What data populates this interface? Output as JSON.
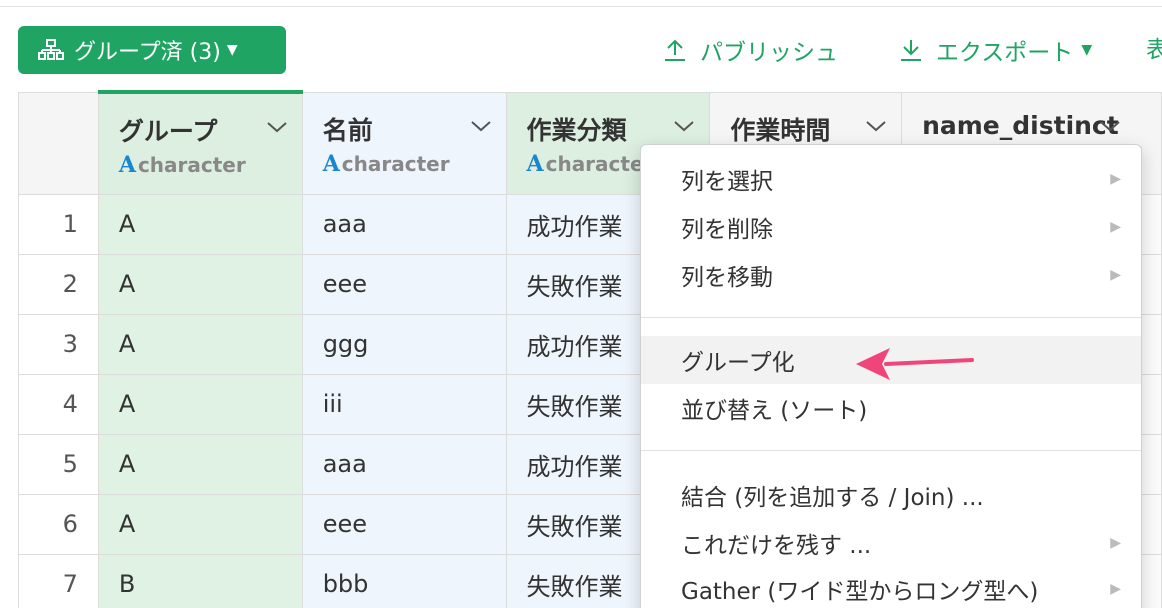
{
  "toolbar": {
    "group_button_label": "グループ済 (3)",
    "publish_label": "パブリッシュ",
    "export_label": "エクスポート",
    "cut_label": "表"
  },
  "columns": [
    {
      "name": "グループ",
      "type": "character"
    },
    {
      "name": "名前",
      "type": "character"
    },
    {
      "name": "作業分類",
      "type": "characte"
    },
    {
      "name": "作業時間",
      "type": ""
    },
    {
      "name": "name_distinct",
      "type": ""
    }
  ],
  "type_glyph": "A",
  "rows": [
    {
      "num": "1",
      "group": "A",
      "name": "aaa",
      "category": "成功作業"
    },
    {
      "num": "2",
      "group": "A",
      "name": "eee",
      "category": "失敗作業"
    },
    {
      "num": "3",
      "group": "A",
      "name": "ggg",
      "category": "成功作業"
    },
    {
      "num": "4",
      "group": "A",
      "name": "iii",
      "category": "失敗作業"
    },
    {
      "num": "5",
      "group": "A",
      "name": "aaa",
      "category": "成功作業"
    },
    {
      "num": "6",
      "group": "A",
      "name": "eee",
      "category": "失敗作業"
    },
    {
      "num": "7",
      "group": "B",
      "name": "bbb",
      "category": "失敗作業"
    }
  ],
  "menu": {
    "items": [
      {
        "label": "列を選択",
        "submenu": true
      },
      {
        "label": "列を削除",
        "submenu": true
      },
      {
        "label": "列を移動",
        "submenu": true
      },
      {
        "label": "グループ化",
        "submenu": false
      },
      {
        "label": "並び替え (ソート)",
        "submenu": false
      },
      {
        "label": "結合 (列を追加する / Join) ...",
        "submenu": false
      },
      {
        "label": "これだけを残す ...",
        "submenu": true
      },
      {
        "label": "Gather (ワイド型からロング型へ)",
        "submenu": true
      }
    ]
  },
  "colors": {
    "accent": "#1fa463",
    "annotation_arrow": "#f0457a",
    "type_icon": "#1a86d0"
  }
}
